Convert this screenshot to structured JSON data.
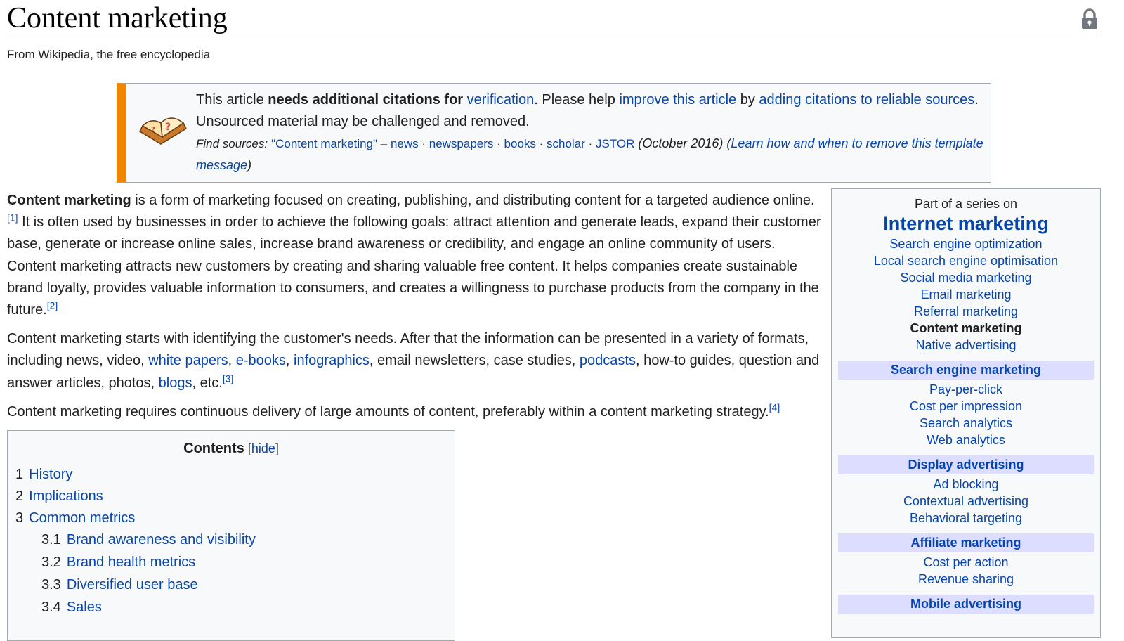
{
  "page": {
    "title": "Content marketing",
    "tagline": "From Wikipedia, the free encyclopedia"
  },
  "icons": {
    "lock": "lock-icon",
    "question_book": "question-book-icon"
  },
  "ambox": {
    "t1": "This article ",
    "t2": "needs additional citations for ",
    "link_verification": "verification",
    "t3": ". Please help ",
    "link_improve": "improve this article",
    "t4": " by ",
    "link_adding": "adding citations to reliable sources",
    "t5": ". Unsourced material may be challenged and removed.",
    "find_label": "Find sources:",
    "find_query": "\"Content marketing\"",
    "dash": " – ",
    "src_news": "news",
    "src_newspapers": "newspapers",
    "src_books": "books",
    "src_scholar": "scholar",
    "src_jstor": "JSTOR",
    "sep": " · ",
    "date": " (October 2016) (",
    "link_learn": "Learn how and when to remove this template message",
    "close": ")"
  },
  "body": {
    "p1_bold": "Content marketing",
    "p1_a": " is a form of marketing focused on creating, publishing, and distributing content for a targeted audience online.",
    "ref1": "[1]",
    "p1_b": " It is often used by businesses in order to achieve the following goals: attract attention and generate leads, expand their customer base, generate or increase online sales, increase brand awareness or credibility, and engage an online community of users. Content marketing attracts new customers by creating and sharing valuable free content. It helps companies create sustainable brand loyalty, provides valuable information to consumers, and creates a willingness to purchase products from the company in the future.",
    "ref2": "[2]",
    "p2_a": "Content marketing starts with identifying the customer's needs. After that the information can be presented in a variety of formats, including news, video, ",
    "link_white_papers": "white papers",
    "comma": ", ",
    "link_ebooks": "e-books",
    "link_infographics": "infographics",
    "p2_b": ", email newsletters, case studies, ",
    "link_podcasts": "podcasts",
    "p2_c": ", how-to guides, question and answer articles, photos, ",
    "link_blogs": "blogs",
    "p2_d": ", etc.",
    "ref3": "[3]",
    "p3": "Content marketing requires continuous delivery of large amounts of content, preferably within a content marketing strategy.",
    "ref4": "[4]"
  },
  "toc": {
    "title": "Contents",
    "hide_open": " [",
    "hide": "hide",
    "hide_close": "]",
    "items": [
      {
        "num": "1",
        "label": "History"
      },
      {
        "num": "2",
        "label": "Implications"
      },
      {
        "num": "3",
        "label": "Common metrics"
      },
      {
        "num": "3.1",
        "label": "Brand awareness and visibility"
      },
      {
        "num": "3.2",
        "label": "Brand health metrics"
      },
      {
        "num": "3.3",
        "label": "Diversified user base"
      },
      {
        "num": "3.4",
        "label": "Sales"
      }
    ]
  },
  "sidebar": {
    "pretitle": "Part of a series on",
    "title": "Internet marketing",
    "items": [
      "Search engine optimization",
      "Local search engine optimisation",
      "Social media marketing",
      "Email marketing",
      "Referral marketing",
      "Content marketing",
      "Native advertising"
    ],
    "groups": [
      {
        "heading": "Search engine marketing",
        "items": [
          "Pay-per-click",
          "Cost per impression",
          "Search analytics",
          "Web analytics"
        ]
      },
      {
        "heading": "Display advertising",
        "items": [
          "Ad blocking",
          "Contextual advertising",
          "Behavioral targeting"
        ]
      },
      {
        "heading": "Affiliate marketing",
        "items": [
          "Cost per action",
          "Revenue sharing"
        ]
      },
      {
        "heading": "Mobile advertising",
        "items": []
      }
    ]
  }
}
